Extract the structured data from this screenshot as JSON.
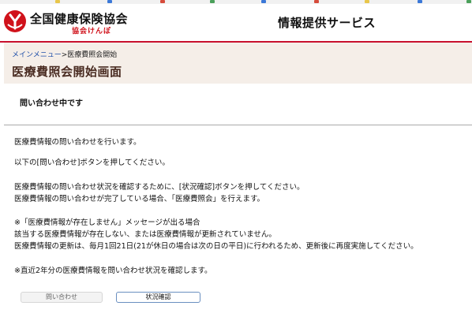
{
  "header": {
    "logo_main": "全国健康保険協会",
    "logo_sub": "協会けんぽ",
    "service_title": "情報提供サービス"
  },
  "breadcrumb": {
    "link": "メインメニュー",
    "separator": ">",
    "current": "医療費照会開始"
  },
  "page": {
    "title": "医療費照会開始画面",
    "status": "問い合わせ中です"
  },
  "body": {
    "line1": "医療費情報の問い合わせを行います。",
    "line2": "以下の[問い合わせ]ボタンを押してください。",
    "line3": "医療費情報の問い合わせ状況を確認するために、[状況確認]ボタンを押してください。",
    "line4": "医療費情報の問い合わせが完了している場合、「医療費照会」を行えます。",
    "line5": "※「医療費情報が存在しません」メッセージが出る場合",
    "line6": "該当する医療費情報が存在しない、または医療費情報が更新されていません。",
    "line7": "医療費情報の更新は、毎月1回21日(21が休日の場合は次の日の平日)に行われるため、更新後に再度実施してください。",
    "line8": "※直近2年分の医療費情報を問い合わせ状況を確認します。"
  },
  "buttons": {
    "inquire": "問い合わせ",
    "status_check": "状況確認"
  },
  "colors": {
    "brand_red": "#d0121b",
    "band_bg": "#f5eee8",
    "title_brown": "#4a2c22",
    "link_blue": "#1f4fa8"
  }
}
